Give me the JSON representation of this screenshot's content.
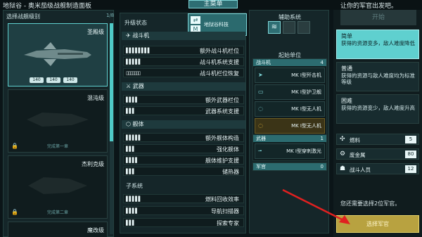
{
  "window": {
    "title": "地狱谷 - 奥米茄级战舰制造面板"
  },
  "top": {
    "main_menu": "主菜单",
    "hint": "让你的军官出发吧。"
  },
  "ship_select": {
    "header": "选择战舰级别",
    "count": "1/8",
    "ships": [
      {
        "name": "圣殿级",
        "unlock": "",
        "stats": [
          "140",
          "140",
          "140"
        ],
        "locked": false
      },
      {
        "name": "混沌级",
        "unlock": "完成第一章",
        "stats": [],
        "locked": true
      },
      {
        "name": "杰利克级",
        "unlock": "完成第二章",
        "stats": [],
        "locked": true
      },
      {
        "name": "魔改级",
        "unlock": "",
        "stats": [],
        "locked": false
      }
    ]
  },
  "upgrades": {
    "header": "升级状态",
    "shipyard_label": "地狱谷科技",
    "categories": [
      {
        "name": "战斗机",
        "items": [
          {
            "bars": "▌▌▌▌▌▌▌▌",
            "name": "额外战斗机栏位"
          },
          {
            "bars": "▌▌▌▌▌",
            "name": "战斗机系统支援"
          },
          {
            "bars": "▯▯▯▯▯▯▯",
            "name": "战斗机栏位恢复"
          }
        ]
      },
      {
        "name": "武器",
        "items": [
          {
            "bars": "▌▌▌▌",
            "name": "额外武器栏位"
          },
          {
            "bars": "▌▌▌",
            "name": "武器系统支援"
          }
        ]
      },
      {
        "name": "舰体",
        "items": [
          {
            "bars": "▌▌▌▌▌",
            "name": "额外舰体构造"
          },
          {
            "bars": "▌▌▌",
            "name": "强化舰体"
          },
          {
            "bars": "▌▌▌▌",
            "name": "舰体维护支援"
          },
          {
            "bars": "▌▌▌",
            "name": "储热器"
          }
        ]
      },
      {
        "name": "子系统",
        "items": [
          {
            "bars": "▌▌▌▌▌",
            "name": "燃料回收效率"
          },
          {
            "bars": "▌▌▌▌",
            "name": "导航扫描器"
          },
          {
            "bars": "▌▌▌",
            "name": "探索专家"
          }
        ]
      }
    ]
  },
  "subsystems": {
    "aux_header": "辅助系统",
    "start_units": "起始单位",
    "groups": [
      {
        "name": "战斗机",
        "count": "4",
        "items": [
          {
            "icon": "fighter-icon",
            "glyph": "➤",
            "name": "MK I型歼击机",
            "warn": false
          },
          {
            "icon": "guard-icon",
            "glyph": "▭",
            "name": "MK I型护卫舰",
            "warn": false
          },
          {
            "icon": "drone-icon",
            "glyph": "◌",
            "name": "MK I型无人机",
            "warn": false
          },
          {
            "icon": "drone-icon",
            "glyph": "◌",
            "name": "MK I型无人机",
            "warn": true
          }
        ]
      },
      {
        "name": "武器",
        "count": "1",
        "items": [
          {
            "icon": "laser-icon",
            "glyph": "╼",
            "name": "MK I型穿刺激光",
            "warn": false
          }
        ]
      },
      {
        "name": "军官",
        "count": "0",
        "items": []
      }
    ]
  },
  "difficulty": {
    "start_label": "开始",
    "options": [
      {
        "title": "简单",
        "desc": "获得的资源变多，敌人难度降低",
        "selected": true
      },
      {
        "title": "普通",
        "desc": "获得的资源与敌人难度均为标准等级",
        "selected": false
      },
      {
        "title": "困难",
        "desc": "获得的资源变少，敌人难度升高",
        "selected": false
      }
    ]
  },
  "resources": [
    {
      "icon": "fuel-icon",
      "glyph": "✣",
      "name": "燃料",
      "value": "5"
    },
    {
      "icon": "scrap-icon",
      "glyph": "⚙",
      "name": "废金属",
      "value": "80"
    },
    {
      "icon": "crew-icon",
      "glyph": "☗",
      "name": "战斗人员",
      "value": "12"
    }
  ],
  "officer": {
    "hint": "您还需要选择2位军官。",
    "button": "选择军官"
  },
  "colors": {
    "accent": "#5fd0cf",
    "panel": "#152629",
    "officer_button": "#b8a240",
    "arrow": "#e02020"
  }
}
